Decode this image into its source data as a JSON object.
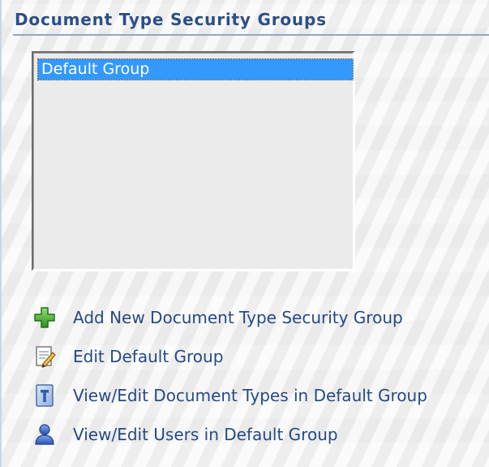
{
  "panel": {
    "title": "Document Type Security Groups"
  },
  "groups_list": {
    "options": [
      {
        "label": "Default Group",
        "selected": true
      }
    ]
  },
  "actions": [
    {
      "label": "Add New Document Type Security Group",
      "icon": "plus-icon"
    },
    {
      "label": "Edit Default Group",
      "icon": "edit-document-icon"
    },
    {
      "label": "View/Edit Document Types in Default Group",
      "icon": "document-type-icon"
    },
    {
      "label": "View/Edit Users in Default Group",
      "icon": "user-icon"
    }
  ],
  "colors": {
    "title": "#2c4f86",
    "link": "#254a86",
    "selection": "#3399ff",
    "plus": "#3aa52a",
    "user": "#3b66c4"
  }
}
